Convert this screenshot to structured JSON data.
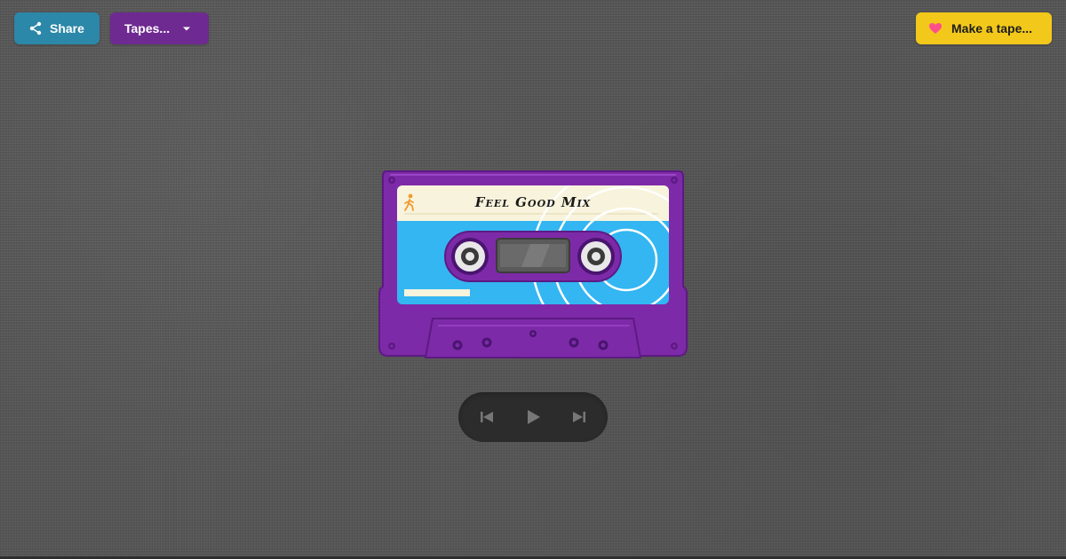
{
  "toolbar": {
    "share_label": "Share",
    "tapes_label": "Tapes...",
    "make_label": "Make a tape..."
  },
  "tape": {
    "title": "Feel Good Mix",
    "icon": "walking-person-icon"
  },
  "player": {
    "controls": [
      "previous-icon",
      "play-icon",
      "next-icon"
    ]
  },
  "colors": {
    "share_button": "#2b88a8",
    "tapes_button": "#6e2a91",
    "make_button": "#f2c81a",
    "heart": "#ff4f8b",
    "cassette_body": "#7d2aa8",
    "label_paper": "#f8f3dc",
    "label_blue": "#33b6f2",
    "player_bg": "#2c2c2c"
  }
}
